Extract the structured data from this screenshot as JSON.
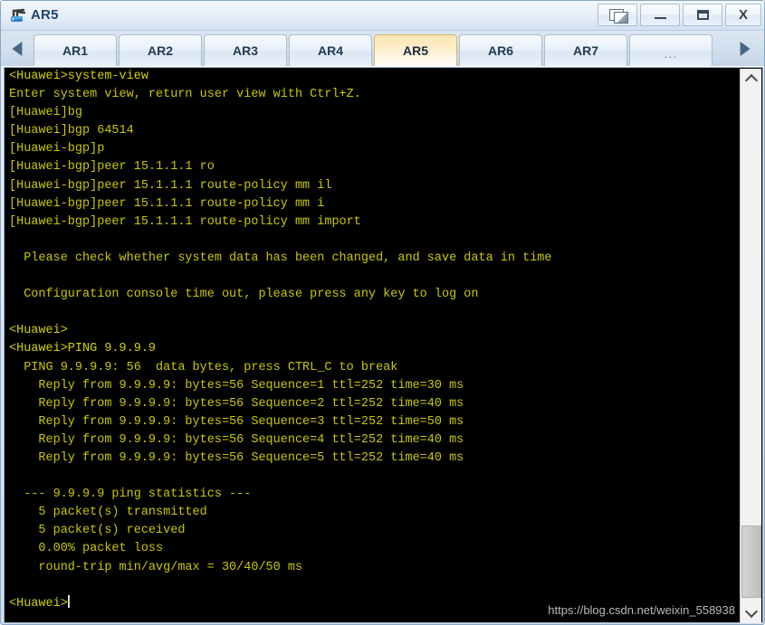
{
  "window": {
    "title": "AR5",
    "icon": "router-icon",
    "controls": [
      {
        "name": "cascade-windows-button",
        "label": ""
      },
      {
        "name": "minimize-button",
        "label": ""
      },
      {
        "name": "maximize-button",
        "label": ""
      },
      {
        "name": "close-button",
        "label": "X"
      }
    ]
  },
  "tabbar": {
    "scroll_left": "◀",
    "scroll_right": "▶",
    "active_tab": "AR5",
    "tabs": [
      {
        "label": "AR1",
        "active": false
      },
      {
        "label": "AR2",
        "active": false
      },
      {
        "label": "AR3",
        "active": false
      },
      {
        "label": "AR4",
        "active": false
      },
      {
        "label": "AR5",
        "active": true
      },
      {
        "label": "AR6",
        "active": false
      },
      {
        "label": "AR7",
        "active": false
      },
      {
        "label": "...",
        "active": false
      }
    ]
  },
  "terminal": {
    "foreground_color": "#c8c800",
    "background_color": "#000000",
    "lines": [
      "<Huawei>system-view",
      "Enter system view, return user view with Ctrl+Z.",
      "[Huawei]bg",
      "[Huawei]bgp 64514",
      "[Huawei-bgp]p",
      "[Huawei-bgp]peer 15.1.1.1 ro",
      "[Huawei-bgp]peer 15.1.1.1 route-policy mm il",
      "[Huawei-bgp]peer 15.1.1.1 route-policy mm i",
      "[Huawei-bgp]peer 15.1.1.1 route-policy mm import",
      "",
      "  Please check whether system data has been changed, and save data in time",
      "",
      "  Configuration console time out, please press any key to log on",
      "",
      "<Huawei>",
      "<Huawei>PING 9.9.9.9",
      "  PING 9.9.9.9: 56  data bytes, press CTRL_C to break",
      "    Reply from 9.9.9.9: bytes=56 Sequence=1 ttl=252 time=30 ms",
      "    Reply from 9.9.9.9: bytes=56 Sequence=2 ttl=252 time=40 ms",
      "    Reply from 9.9.9.9: bytes=56 Sequence=3 ttl=252 time=50 ms",
      "    Reply from 9.9.9.9: bytes=56 Sequence=4 ttl=252 time=40 ms",
      "    Reply from 9.9.9.9: bytes=56 Sequence=5 ttl=252 time=40 ms",
      "",
      "  --- 9.9.9.9 ping statistics ---",
      "    5 packet(s) transmitted",
      "    5 packet(s) received",
      "    0.00% packet loss",
      "    round-trip min/avg/max = 30/40/50 ms",
      "",
      "<Huawei>"
    ],
    "cursor_line_index": 29
  },
  "watermark": {
    "text": "https://blog.csdn.net/weixin_558938"
  },
  "scrollbar": {
    "up_arrow": "▲",
    "down_arrow": "▼",
    "thumb_position_percent": 85
  }
}
